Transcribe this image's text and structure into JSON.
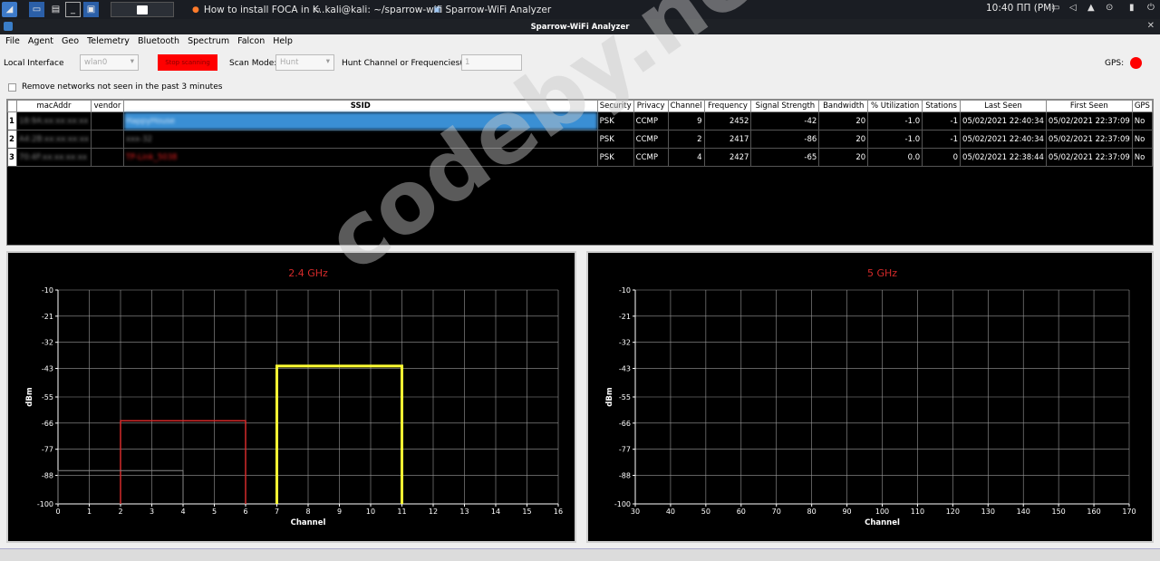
{
  "taskbar": {
    "tasks": [
      {
        "label": "How to install FOCA in K..."
      },
      {
        "label": "kali@kali: ~/sparrow-wifi"
      },
      {
        "label": "Sparrow-WiFi Analyzer"
      }
    ],
    "clock": "10:40 ПП (PM)"
  },
  "window": {
    "title": "Sparrow-WiFi Analyzer"
  },
  "menu": [
    "File",
    "Agent",
    "Geo",
    "Telemetry",
    "Bluetooth",
    "Spectrum",
    "Falcon",
    "Help"
  ],
  "toolbar": {
    "local_interface_label": "Local Interface",
    "interface_value": "wlan0",
    "scan_button_label": "Stop scanning",
    "scan_mode_label": "Scan Mode:",
    "scan_mode_value": "Hunt",
    "hunt_label": "Hunt Channel or Frequencies(s):",
    "hunt_value": "1",
    "gps_label": "GPS:",
    "remove_label": "Remove networks not seen in the past 3 minutes"
  },
  "table": {
    "columns": [
      "macAddr",
      "vendor",
      "SSID",
      "Security",
      "Privacy",
      "Channel",
      "Frequency",
      "Signal Strength",
      "Bandwidth",
      "% Utilization",
      "Stations",
      "Last Seen",
      "First Seen",
      "GPS"
    ],
    "rows": [
      {
        "n": "1",
        "mac": "18:9A:xx:xx:xx:xx",
        "vendor": "",
        "ssid": "HappyHouse",
        "security": "PSK",
        "privacy": "CCMP",
        "channel": "9",
        "frequency": "2452",
        "signal": "-42",
        "bandwidth": "20",
        "util": "-1.0",
        "stations": "-1",
        "last": "05/02/2021 22:40:34",
        "first": "05/02/2021 22:37:09",
        "gps": "No"
      },
      {
        "n": "2",
        "mac": "A4:2B:xx:xx:xx:xx",
        "vendor": "",
        "ssid": "xxx-32",
        "security": "PSK",
        "privacy": "CCMP",
        "channel": "2",
        "frequency": "2417",
        "signal": "-86",
        "bandwidth": "20",
        "util": "-1.0",
        "stations": "-1",
        "last": "05/02/2021 22:40:34",
        "first": "05/02/2021 22:37:09",
        "gps": "No"
      },
      {
        "n": "3",
        "mac": "70:4F:xx:xx:xx:xx",
        "vendor": "",
        "ssid": "TP-Link_5038",
        "security": "PSK",
        "privacy": "CCMP",
        "channel": "4",
        "frequency": "2427",
        "signal": "-65",
        "bandwidth": "20",
        "util": "0.0",
        "stations": "0",
        "last": "05/02/2021 22:38:44",
        "first": "05/02/2021 22:37:09",
        "gps": "No"
      }
    ]
  },
  "chart_data": [
    {
      "type": "area",
      "title": "2.4 GHz",
      "xlabel": "Channel",
      "ylabel": "dBm",
      "xlim": [
        0,
        16
      ],
      "ylim": [
        -100,
        -10
      ],
      "xticks": [
        0,
        1,
        2,
        3,
        4,
        5,
        6,
        7,
        8,
        9,
        10,
        11,
        12,
        13,
        14,
        15,
        16
      ],
      "yticks": [
        -10,
        -21,
        -32,
        -43,
        -55,
        -66,
        -77,
        -88,
        -100
      ],
      "grid": true,
      "series": [
        {
          "channel": 9,
          "x_start": 7,
          "x_end": 11,
          "signal": -42,
          "color": "#ffff33"
        },
        {
          "channel": 4,
          "x_start": 2,
          "x_end": 6,
          "signal": -65,
          "color": "#d42a2a"
        },
        {
          "channel": 2,
          "x_start": 0,
          "x_end": 4,
          "signal": -86,
          "color": "#888888"
        }
      ]
    },
    {
      "type": "area",
      "title": "5 GHz",
      "xlabel": "Channel",
      "ylabel": "dBm",
      "xlim": [
        30,
        170
      ],
      "ylim": [
        -100,
        -10
      ],
      "xticks": [
        30,
        40,
        50,
        60,
        70,
        80,
        90,
        100,
        110,
        120,
        130,
        140,
        150,
        160,
        170
      ],
      "yticks": [
        -10,
        -21,
        -32,
        -43,
        -55,
        -66,
        -77,
        -88,
        -100
      ],
      "grid": true,
      "series": []
    }
  ],
  "colors": {
    "chart_title": "#d42a2a",
    "gps_indicator": "#ff0000",
    "scan_button": "#ff0000",
    "selected_row": "#3a8fd4"
  },
  "watermark": "codeby.net"
}
